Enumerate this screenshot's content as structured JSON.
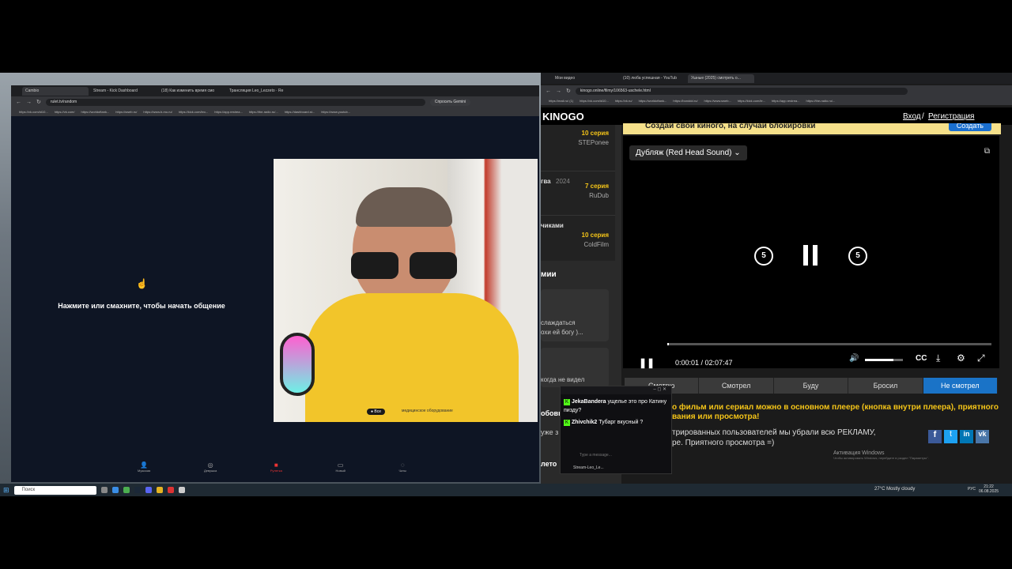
{
  "left": {
    "tabs": [
      "Cambio",
      "Stream - Kick Dashboard",
      "(18) Как изменить время смо",
      "Трансляция Leo_Lezzeto · Rе"
    ],
    "url": "rulet.tv/random",
    "gemini": "Спросить Gemini",
    "bookmarks": [
      "https://vk.com/id10...",
      "https://vk.com/",
      "https://worldoftank...",
      "https://sweb.ru/",
      "https://www.b-mu.ru/",
      "https://kick.com/leo...",
      "https://app.restrea...",
      "https://the-radio.ru/...",
      "https://dashboard.st...",
      "https://www.youtub..."
    ],
    "start_text": "Нажмите или смахните, чтобы начать общение",
    "video_tag1": "Все",
    "video_tag2": "медицинское оборудование",
    "nav": [
      "Мужская",
      "Девушка",
      "Рулетка",
      "Новый",
      "Чаты"
    ]
  },
  "right": {
    "tabs": [
      "Мои видео",
      "(10) люба успешная - YouTub",
      "Ушные (2025) смотреть о..."
    ],
    "url": "kinogo.online/filmy/106563-uschele.html",
    "gemini": "Спросить Gemini",
    "bookmarks": [
      "https://mail.ru/ (1)",
      "https://vk.com/id10...",
      "https://vk.ru/",
      "https://worldoftank...",
      "https://bonddd.ru/",
      "https://www.sweb...",
      "https://kick.com/le...",
      "https://app.restrea...",
      "https://the-radio.ru/..."
    ],
    "logo": "KINOGO",
    "login": "Вход",
    "register": "Регистрация",
    "banner": "Создай свой киного, на случай блокировки",
    "create": "Создать",
    "sidebar": [
      {
        "ep": "10 серия",
        "studio": "STEPonee",
        "title": "",
        "year": ""
      },
      {
        "ep": "7 серия",
        "studio": "RuDub",
        "title": "гва",
        "year": "2024"
      },
      {
        "ep": "10 серия",
        "studio": "ColdFilm",
        "title": "чиками",
        "year": ""
      }
    ],
    "section": "мии",
    "comment1a": "слаждаться",
    "comment1b": "охи ей богу )...",
    "comment2": "когда не видел",
    "word_row1": "обовь",
    "word_row2": "уже з",
    "word_row3": "лето",
    "dub": "Дубляж (Red Head Sound)",
    "skip_back": "5",
    "skip_fwd": "5",
    "time": "0:00:01 / 02:07:47",
    "cc": "CC",
    "progress": 0.005,
    "volume": 0.75,
    "segments": [
      "Смотрю",
      "Смотрел",
      "Буду",
      "Бросил",
      "Не смотрел"
    ],
    "info1": "о фильм или сериал можно в основном плеере (кнопка внутри плеера), приятного",
    "info2": "вания или просмотра!",
    "info3": "трированных пользователей мы убрали всю РЕКЛАМУ,",
    "info4": "ре. Приятного просмотра =)",
    "activation": "Активация Windows",
    "activation_sub": "Чтобы активировать Windows, перейдите в раздел \"Параметры\"."
  },
  "chat": {
    "messages": [
      {
        "user": "JekaBandera",
        "text": "ущелье это про Катину пизду?"
      },
      {
        "user": "Zhivchik2",
        "text": "Тубарг вкусный ?"
      }
    ],
    "placeholder": "Type a message...",
    "footer": "Stream-Leo_Le..."
  },
  "taskbar": {
    "search": "Поиск",
    "weather": "27°C Mostly cloudy",
    "lang": "РУС",
    "time": "21:22",
    "date": "06.08.2025"
  }
}
